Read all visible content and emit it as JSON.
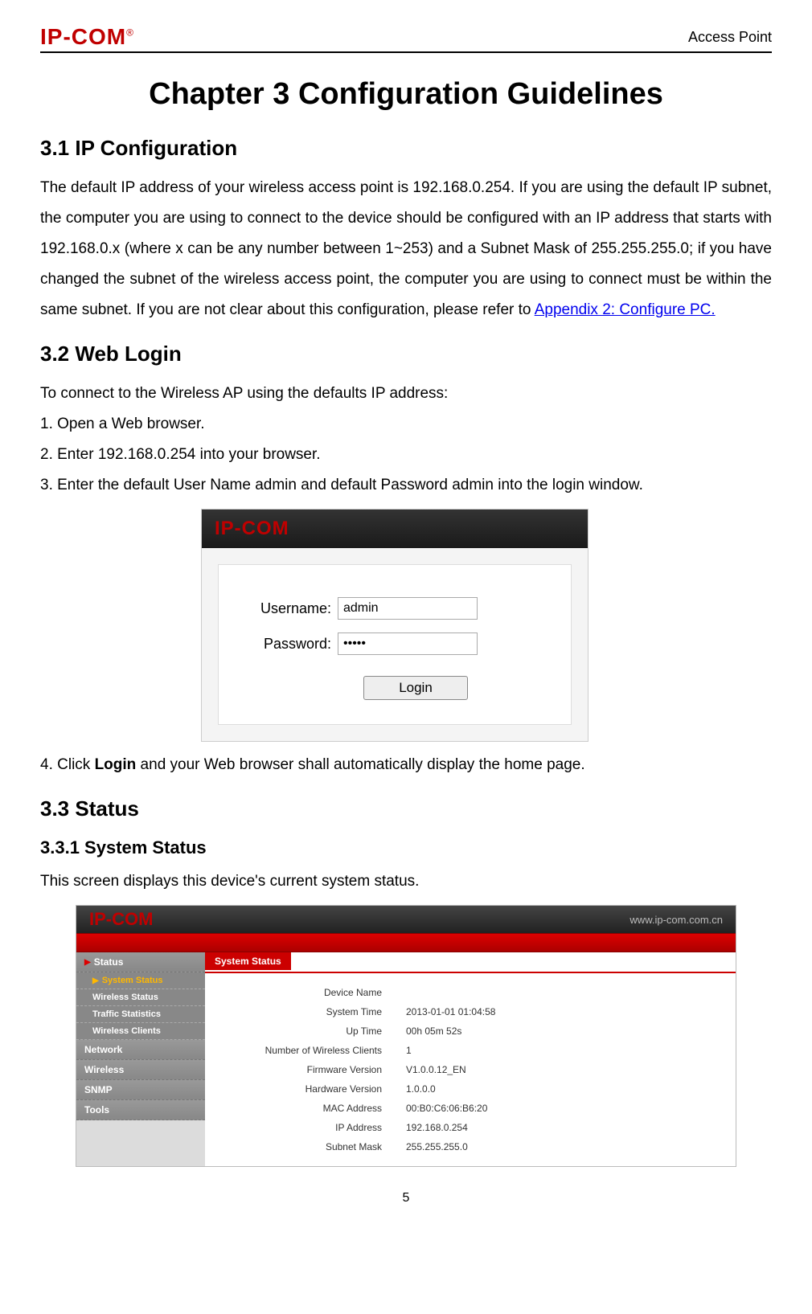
{
  "header": {
    "logo_text": "IP-COM",
    "right_text": "Access Point"
  },
  "chapter_title": "Chapter 3 Configuration Guidelines",
  "section_31": {
    "heading": "3.1 IP Configuration",
    "paragraph": "The default IP address of your wireless access point is 192.168.0.254. If you are using the default IP subnet, the computer you are using to connect to the device should be configured with an IP address that starts with 192.168.0.x (where x can be any number between 1~253) and a Subnet Mask of 255.255.255.0; if you have changed the subnet of the wireless access point, the computer you are using to connect must be within the same subnet. If you are not clear about this configuration, please refer to ",
    "link_text": "Appendix 2: Configure PC."
  },
  "section_32": {
    "heading": "3.2 Web Login",
    "intro": "To connect to the Wireless AP using the defaults IP address:",
    "step1": "1. Open a Web browser.",
    "step2": "2. Enter 192.168.0.254 into your browser.",
    "step3": "3. Enter the default User Name admin and default Password admin into the login window.",
    "step4_a": "4. Click ",
    "step4_b": "Login",
    "step4_c": " and your Web browser shall automatically display the home page."
  },
  "login_panel": {
    "logo": "IP-COM",
    "username_label": "Username:",
    "username_value": "admin",
    "password_label": "Password:",
    "password_value": "•••••",
    "login_button": "Login"
  },
  "section_33": {
    "heading": "3.3 Status",
    "sub_heading": "3.3.1 System Status",
    "text": "This screen displays this device's current system status."
  },
  "status_panel": {
    "logo": "IP-COM",
    "url": "www.ip-com.com.cn",
    "tab": "System Status",
    "sidebar": {
      "status_section": "Status",
      "items": [
        "System Status",
        "Wireless Status",
        "Traffic Statistics",
        "Wireless Clients"
      ],
      "network": "Network",
      "wireless": "Wireless",
      "snmp": "SNMP",
      "tools": "Tools"
    },
    "fields": [
      {
        "label": "Device Name",
        "value": ""
      },
      {
        "label": "System Time",
        "value": "2013-01-01 01:04:58"
      },
      {
        "label": "Up Time",
        "value": "00h 05m 52s"
      },
      {
        "label": "Number of Wireless Clients",
        "value": "1"
      },
      {
        "label": "Firmware Version",
        "value": "V1.0.0.12_EN"
      },
      {
        "label": "Hardware Version",
        "value": "1.0.0.0"
      },
      {
        "label": "MAC Address",
        "value": "00:B0:C6:06:B6:20"
      },
      {
        "label": "IP Address",
        "value": "192.168.0.254"
      },
      {
        "label": "Subnet Mask",
        "value": "255.255.255.0"
      }
    ]
  },
  "page_number": "5"
}
